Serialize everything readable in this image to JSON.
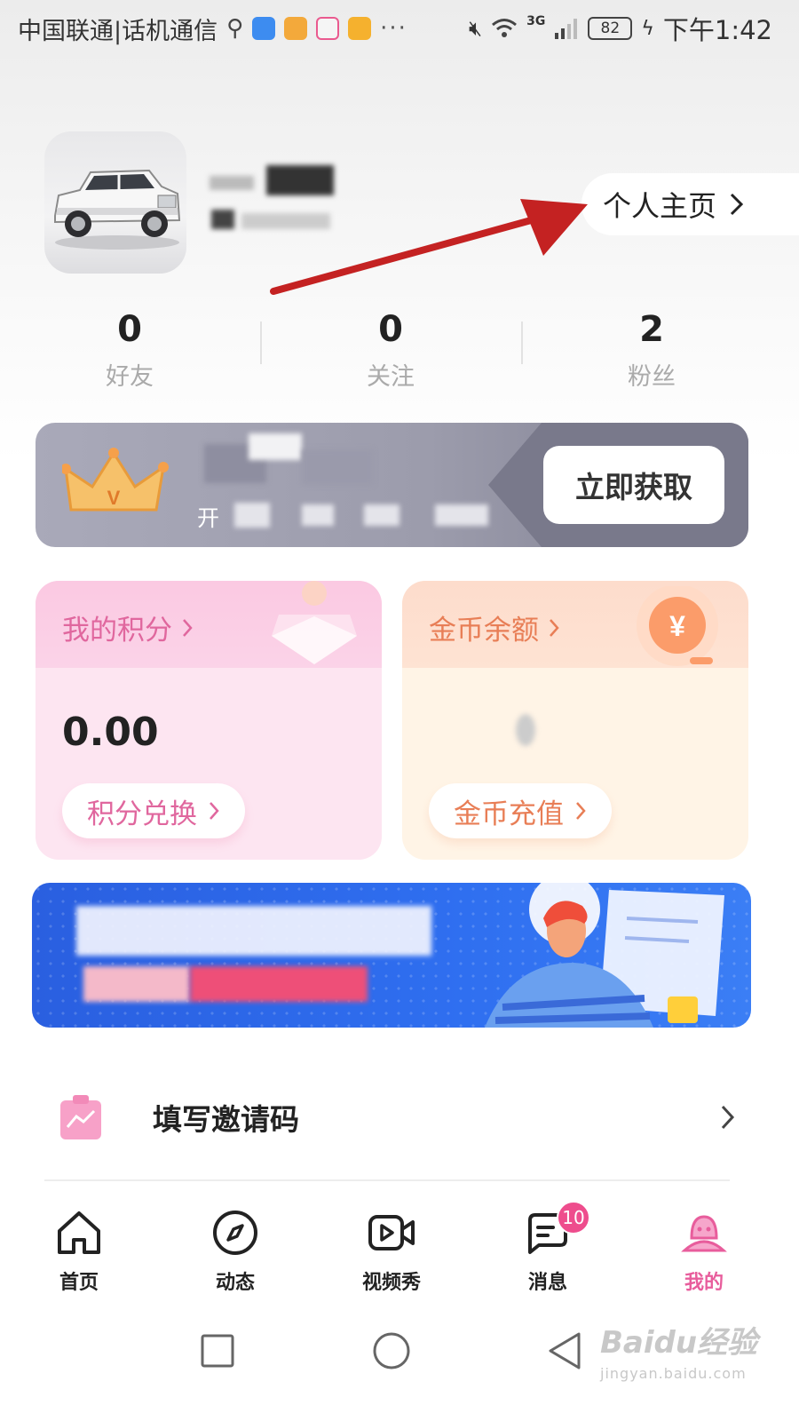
{
  "status_bar": {
    "carrier": "中国联通|话机通信",
    "network": "3G",
    "battery": "82",
    "time": "下午1:42",
    "icons": [
      "usb-icon",
      "shield-app-icon",
      "download-app-icon",
      "chat-app-icon",
      "video-app-icon",
      "more-icon",
      "mute-icon",
      "wifi-icon",
      "signal-icon",
      "battery-icon",
      "charging-icon"
    ]
  },
  "profile": {
    "homepage_label": "个人主页",
    "stats": [
      {
        "value": "0",
        "label": "好友"
      },
      {
        "value": "0",
        "label": "关注"
      },
      {
        "value": "2",
        "label": "粉丝"
      }
    ]
  },
  "vip_banner": {
    "subtitle": "开",
    "cta_label": "立即获取",
    "crown_letter": "V"
  },
  "cards": {
    "points": {
      "title": "我的积分",
      "value": "0.00",
      "action": "积分兑换"
    },
    "coins": {
      "title": "金币余额",
      "action": "金币充值",
      "coin_symbol": "¥"
    }
  },
  "list": {
    "invite_label": "填写邀请码"
  },
  "tabbar": {
    "items": [
      {
        "label": "首页",
        "icon": "home-icon"
      },
      {
        "label": "动态",
        "icon": "compass-icon"
      },
      {
        "label": "视频秀",
        "icon": "video-icon"
      },
      {
        "label": "消息",
        "icon": "message-icon",
        "badge": "10"
      },
      {
        "label": "我的",
        "icon": "profile-icon",
        "active": true
      }
    ]
  },
  "watermark": {
    "logo": "Baidu经验",
    "url": "jingyan.baidu.com"
  },
  "colors": {
    "accent_pink": "#e85d9c",
    "annotation_arrow": "#c42222",
    "promo_blue": "#2f6ff0"
  }
}
